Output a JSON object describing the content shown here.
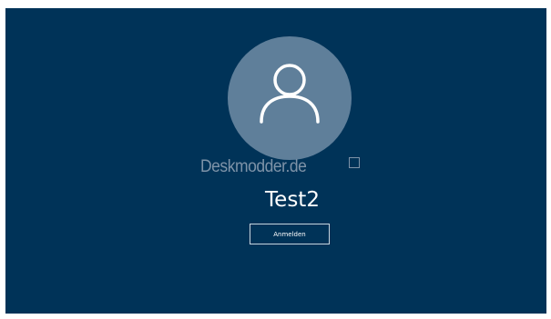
{
  "lockscreen": {
    "background_color": "#003358",
    "avatar": {
      "icon": "user-icon",
      "circle_color": "#5f7f9a"
    },
    "watermark": {
      "text": "Deskmodder.de"
    },
    "user": {
      "name": "Test2"
    },
    "signin": {
      "label": "Anmelden"
    }
  }
}
